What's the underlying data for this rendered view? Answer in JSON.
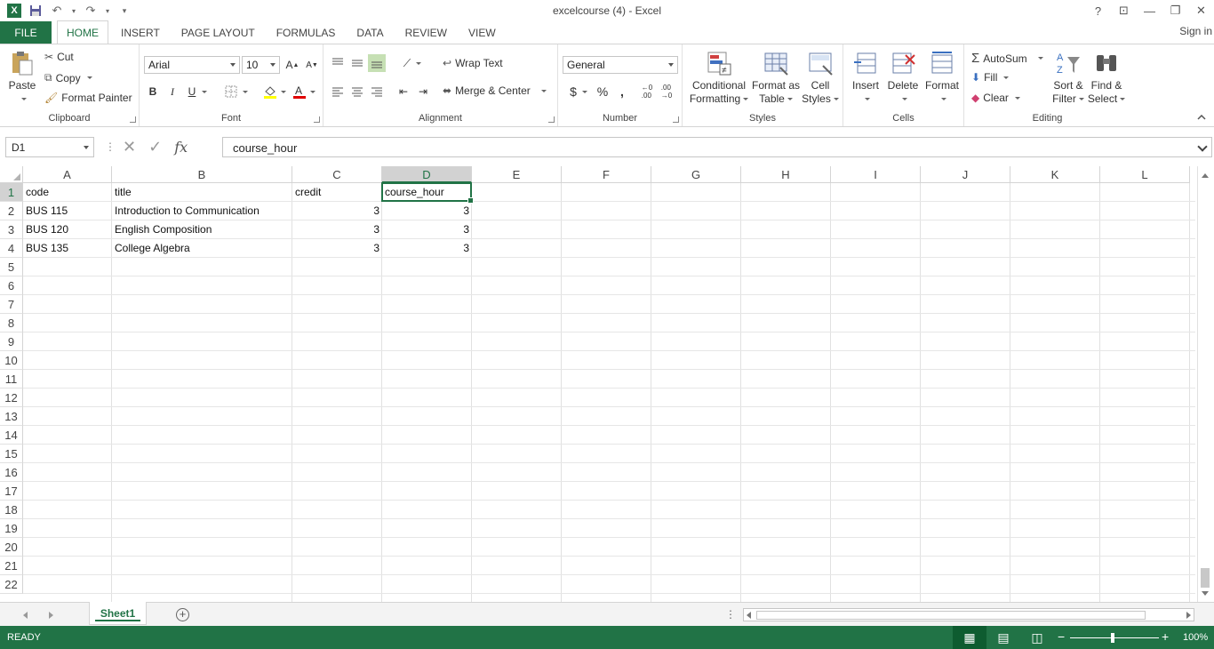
{
  "window": {
    "title": "excelcourse (4) - Excel",
    "help": "?",
    "minimize": "—",
    "restore": "❐",
    "close": "✕"
  },
  "ribbon_tabs": [
    "FILE",
    "HOME",
    "INSERT",
    "PAGE LAYOUT",
    "FORMULAS",
    "DATA",
    "REVIEW",
    "VIEW"
  ],
  "active_tab": "HOME",
  "signin": "Sign in",
  "clipboard": {
    "paste": "Paste",
    "cut": "Cut",
    "copy": "Copy",
    "format_painter": "Format Painter",
    "label": "Clipboard"
  },
  "font": {
    "name": "Arial",
    "size": "10",
    "bold": "B",
    "italic": "I",
    "underline": "U",
    "label": "Font"
  },
  "alignment": {
    "wrap_text": "Wrap Text",
    "merge_center": "Merge & Center",
    "label": "Alignment"
  },
  "number": {
    "format": "General",
    "currency": "$",
    "percent": "%",
    "comma": ",",
    "label": "Number"
  },
  "styles": {
    "conditional": [
      "Conditional",
      "Formatting"
    ],
    "format_table": [
      "Format as",
      "Table"
    ],
    "cell_styles": [
      "Cell",
      "Styles"
    ],
    "label": "Styles"
  },
  "cells": {
    "insert": "Insert",
    "delete": "Delete",
    "format": "Format",
    "label": "Cells"
  },
  "editing": {
    "autosum": "AutoSum",
    "fill": "Fill",
    "clear": "Clear",
    "sort_filter": [
      "Sort &",
      "Filter"
    ],
    "find_select": [
      "Find &",
      "Select"
    ],
    "label": "Editing"
  },
  "formula_bar": {
    "name_box": "D1",
    "content": "course_hour",
    "fx": "fx"
  },
  "columns": [
    "A",
    "B",
    "C",
    "D",
    "E",
    "F",
    "G",
    "H",
    "I",
    "J",
    "K",
    "L"
  ],
  "rows": [
    "1",
    "2",
    "3",
    "4",
    "5",
    "6",
    "7",
    "8",
    "9",
    "10",
    "11",
    "12",
    "13",
    "14",
    "15",
    "16",
    "17",
    "18",
    "19",
    "20",
    "21",
    "22"
  ],
  "cells_data": [
    [
      "code",
      "title",
      "credit",
      "course_hour"
    ],
    [
      "BUS 115",
      "Introduction to Communication",
      "3",
      "3"
    ],
    [
      "BUS 120",
      "English Composition",
      "3",
      "3"
    ],
    [
      "BUS 135",
      "College Algebra",
      "3",
      "3"
    ]
  ],
  "sheet_tabs": [
    "Sheet1"
  ],
  "status": {
    "ready": "READY",
    "zoom": "100%"
  }
}
